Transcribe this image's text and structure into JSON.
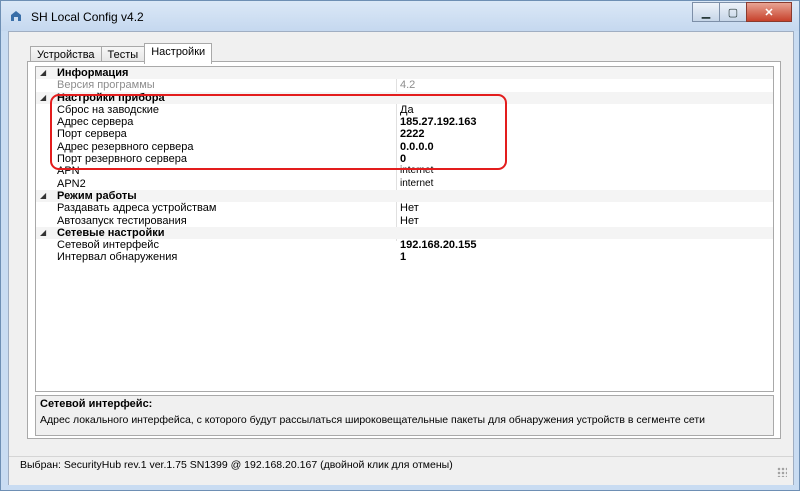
{
  "window": {
    "title": "SH Local Config v4.2",
    "buttons": {
      "minimize": "▁",
      "maximize": "▢",
      "close": "✕"
    }
  },
  "tabs": [
    {
      "label": "Устройства",
      "active": false
    },
    {
      "label": "Тесты",
      "active": false
    },
    {
      "label": "Настройки",
      "active": true
    }
  ],
  "properties": {
    "info": {
      "label": "Информация",
      "rows": [
        {
          "key": "Версия программы",
          "value": "4.2"
        }
      ]
    },
    "device": {
      "label": "Настройки прибора",
      "rows": [
        {
          "key": "Сброс на заводские",
          "value": "Да"
        },
        {
          "key": "Адрес сервера",
          "value": "185.27.192.163"
        },
        {
          "key": "Порт сервера",
          "value": "2222"
        },
        {
          "key": "Адрес резервного сервера",
          "value": "0.0.0.0"
        },
        {
          "key": "Порт резервного сервера",
          "value": "0"
        },
        {
          "key": "APN",
          "value": "internet"
        },
        {
          "key": "APN2",
          "value": "internet"
        }
      ]
    },
    "mode": {
      "label": "Режим работы",
      "rows": [
        {
          "key": "Раздавать адреса устройствам",
          "value": "Нет"
        },
        {
          "key": "Автозапуск тестирования",
          "value": "Нет"
        }
      ]
    },
    "network": {
      "label": "Сетевые настройки",
      "rows": [
        {
          "key": "Сетевой интерфейс",
          "value": "192.168.20.155"
        },
        {
          "key": "Интервал обнаружения",
          "value": "1"
        }
      ]
    },
    "toggle_glyph": "◢"
  },
  "help": {
    "title": "Сетевой интерфейс:",
    "description": "Адрес локального интерфейса, с которого будут рассылаться широковещательные пакеты для обнаружения устройств в сегменте сети"
  },
  "status": {
    "text": "Выбран: SecurityHub rev.1 ver.1.75 SN1399 @ 192.168.20.167 (двойной клик для отмены)"
  },
  "colors": {
    "highlight": "#e31d1d",
    "titlebar": "#c5d8ef"
  }
}
